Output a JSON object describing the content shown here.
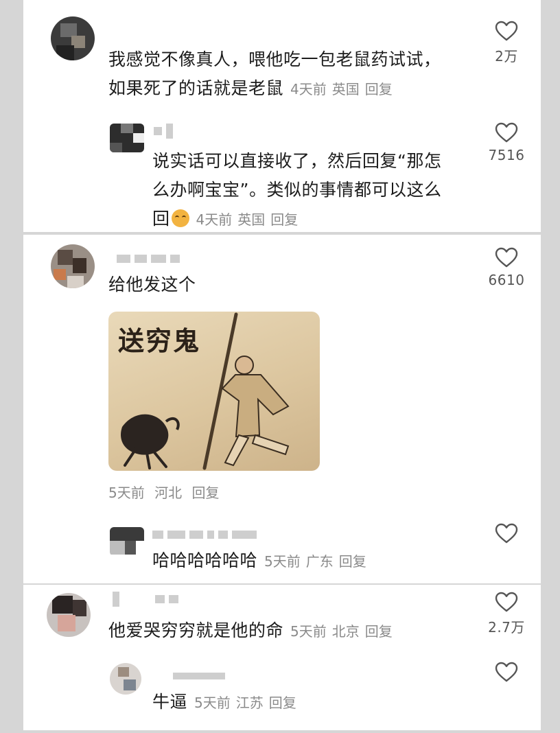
{
  "comments": [
    {
      "text_lines": [
        "我感觉不像真人，喂他吃一包老鼠药试试，",
        "如果死了的话就是老鼠"
      ],
      "meta": {
        "time": "4天前",
        "location": "英国",
        "reply": "回复"
      },
      "likes": "2万",
      "replies": [
        {
          "text_lines": [
            "说实话可以直接收了，然后回复“那怎",
            "么办啊宝宝”。类似的事情都可以这么",
            "回"
          ],
          "emoji": "laughing-cat-emoji",
          "meta": {
            "time": "4天前",
            "location": "英国",
            "reply": "回复"
          },
          "likes": "7516"
        }
      ]
    },
    {
      "text_lines": [
        "给他发这个"
      ],
      "image": {
        "caption": "送穷鬼"
      },
      "meta": {
        "time": "5天前",
        "location": "河北",
        "reply": "回复"
      },
      "likes": "6610",
      "replies": [
        {
          "text_lines": [
            "哈哈哈哈哈哈"
          ],
          "meta": {
            "time": "5天前",
            "location": "广东",
            "reply": "回复"
          },
          "likes": ""
        }
      ]
    },
    {
      "text_lines": [
        "他爱哭穷穷就是他的命"
      ],
      "meta": {
        "time": "5天前",
        "location": "北京",
        "reply": "回复"
      },
      "likes": "2.7万",
      "replies": [
        {
          "text_lines": [
            "牛逼"
          ],
          "meta": {
            "time": "5天前",
            "location": "江苏",
            "reply": "回复"
          },
          "likes": ""
        }
      ]
    }
  ],
  "colors": {
    "background": "#d6d6d6",
    "card": "#ffffff",
    "text": "#1c1c1c",
    "meta": "#8a8a8a"
  },
  "icons": {
    "like": "heart-outline-icon"
  }
}
